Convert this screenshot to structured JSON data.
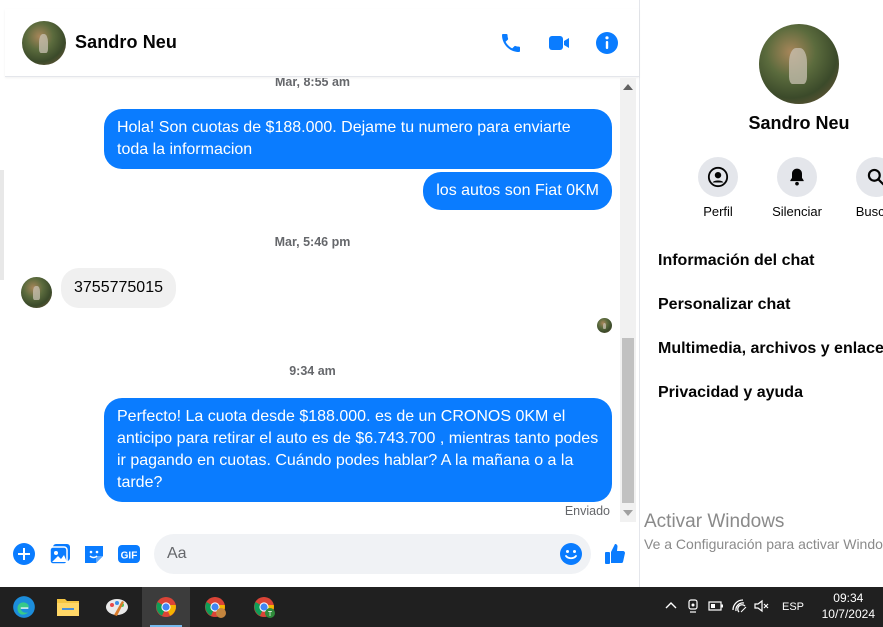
{
  "header": {
    "name": "Sandro Neu"
  },
  "messages": {
    "timestamps": [
      "Mar, 8:55 am",
      "Mar, 5:46 pm",
      "9:34 am"
    ],
    "out1": "Hola! Son cuotas de $188.000. Dejame tu numero para enviarte toda la informacion",
    "out2": "los autos son Fiat 0KM",
    "in1": "3755775015",
    "out3": "Perfecto! La cuota desde $188.000. es de un CRONOS 0KM el anticipo para retirar el auto es de $6.743.700 , mientras tanto podes ir pagando en cuotas. Cuándo podes hablar? A la mañana o a la tarde?",
    "status": "Enviado"
  },
  "composer": {
    "placeholder": "Aa"
  },
  "info_panel": {
    "name": "Sandro Neu",
    "actions": [
      "Perfil",
      "Silenciar",
      "Buscar"
    ],
    "menu": [
      "Información del chat",
      "Personalizar chat",
      "Multimedia, archivos y enlaces",
      "Privacidad y ayuda"
    ]
  },
  "watermark": {
    "title": "Activar Windows",
    "subtitle": "Ve a Configuración para activar Windows."
  },
  "taskbar": {
    "apps": [
      "edge-icon",
      "file-explorer-icon",
      "paint-icon",
      "chrome-icon",
      "chrome-profile-icon",
      "chrome-profile-t-icon"
    ],
    "language": "ESP",
    "time": "09:34",
    "date": "10/7/2024"
  },
  "colors": {
    "accent": "#0a7cff",
    "bubble_in": "#f0f0f0",
    "taskbar": "#202020"
  }
}
